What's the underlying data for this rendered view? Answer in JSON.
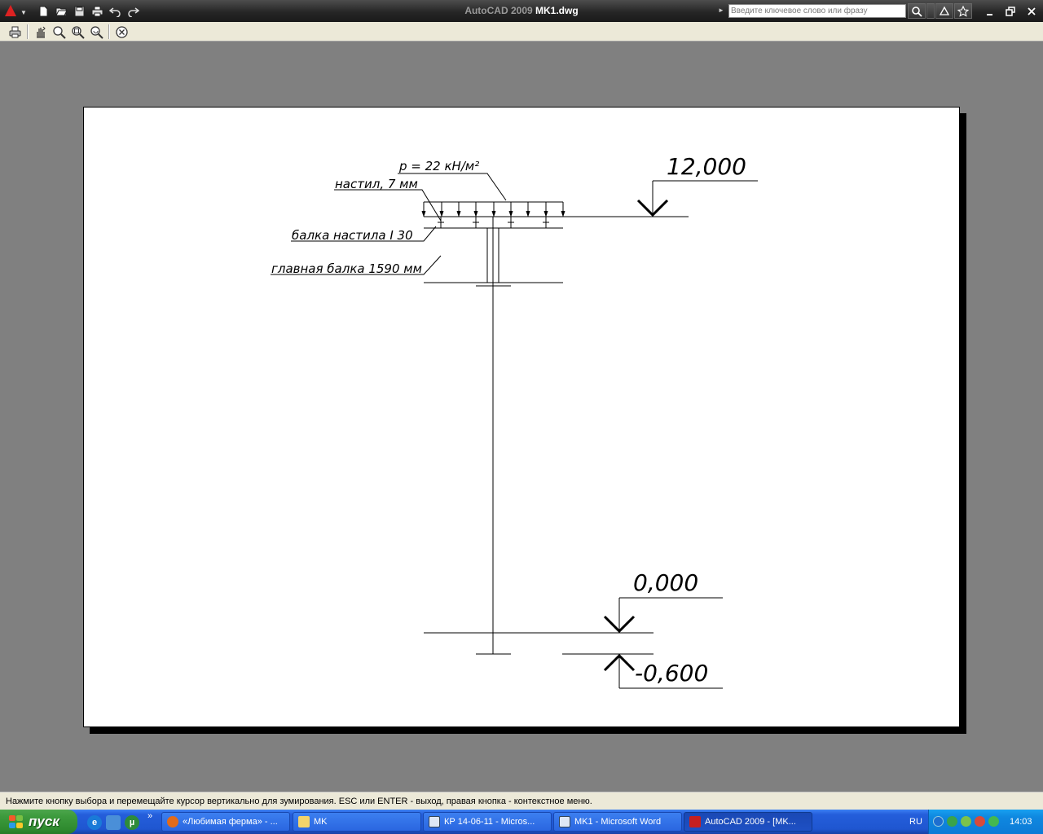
{
  "window": {
    "title_product": "AutoCAD 2009",
    "title_file": "MK1.dwg",
    "search_placeholder": "Введите ключевое слово или фразу"
  },
  "quick_access_icons": [
    "new-icon",
    "open-icon",
    "save-icon",
    "print-icon",
    "undo-icon",
    "redo-icon"
  ],
  "preview_toolbar_icons": [
    "print-icon",
    "pan-icon",
    "zoom-realtime-icon",
    "zoom-window-icon",
    "zoom-previous-icon",
    "close-preview-icon"
  ],
  "drawing": {
    "load_label": "р = 22 кН/м²",
    "deck_label": "настил, 7 мм",
    "deck_beam_label": "балка настила I 30",
    "main_beam_label": "главная балка 1590 мм",
    "elevation_top": "12,000",
    "elevation_ground": "0,000",
    "elevation_foundation": "-0,600"
  },
  "status_line": "Нажмите кнопку выбора и перемещайте курсор вертикально для зумирования. ESC или ENTER - выход, правая кнопка - контекстное меню.",
  "taskbar": {
    "start_label": "пуск",
    "tasks": [
      {
        "label": "«Любимая ферма» - ...",
        "icon": "firefox-icon",
        "active": false
      },
      {
        "label": "MK",
        "icon": "folder-icon",
        "active": false
      },
      {
        "label": "КР 14-06-11 - Micros...",
        "icon": "word-icon",
        "active": false
      },
      {
        "label": "MK1 - Microsoft Word",
        "icon": "word-icon",
        "active": false
      },
      {
        "label": "AutoCAD 2009 - [MK...",
        "icon": "autocad-icon",
        "active": true
      }
    ],
    "language": "RU",
    "clock": "14:03"
  },
  "colors": {
    "titlebar": "#262626",
    "workspace": "#808080",
    "paper": "#ffffff",
    "taskbar": "#245edb",
    "start_button": "#3c9a3c",
    "tray": "#0f88e0"
  }
}
